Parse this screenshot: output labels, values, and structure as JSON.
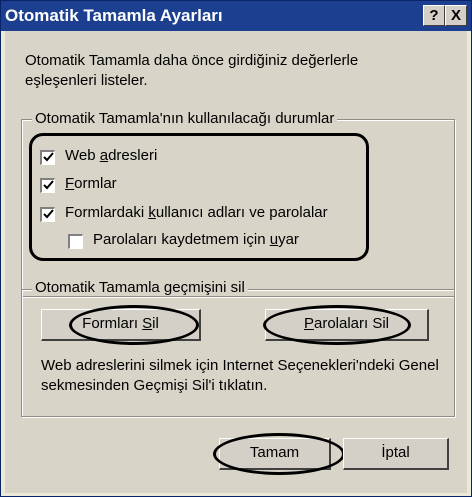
{
  "window": {
    "title": "Otomatik Tamamla Ayarları",
    "help_label": "?",
    "close_label": "X"
  },
  "intro_text": "Otomatik Tamamla daha önce girdiğiniz değerlerle eşleşenleri listeler.",
  "usage_group": {
    "legend": "Otomatik Tamamla'nın kullanılacağı durumlar",
    "options": [
      {
        "pre": "Web ",
        "accel": "a",
        "post": "dresleri",
        "checked": true
      },
      {
        "pre": "",
        "accel": "F",
        "post": "ormlar",
        "checked": true
      },
      {
        "pre": "Formlardaki ",
        "accel": "k",
        "post": "ullanıcı adları ve parolalar",
        "checked": true
      },
      {
        "pre": "Parolaları kaydetmem için ",
        "accel": "u",
        "post": "yar",
        "checked": false
      }
    ]
  },
  "history_group": {
    "legend": "Otomatik Tamamla geçmişini sil",
    "clear_forms": {
      "pre": "Formları ",
      "accel": "S",
      "post": "il"
    },
    "clear_passwords": {
      "pre": "",
      "accel": "P",
      "post": "arolaları Sil"
    },
    "note": "Web adreslerini silmek için Internet Seçenekleri'ndeki Genel sekmesinden Geçmişi Sil'i tıklatın."
  },
  "footer": {
    "ok_label": "Tamam",
    "cancel_label": "İptal"
  }
}
